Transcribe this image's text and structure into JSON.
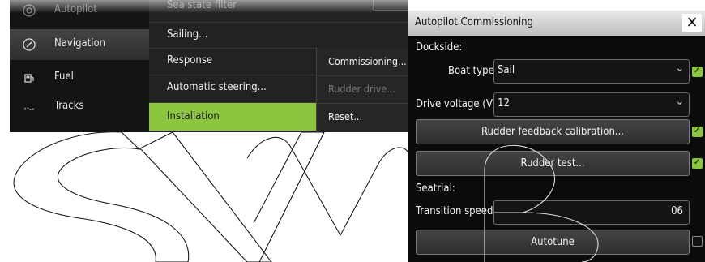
{
  "sidebar": {
    "items": [
      {
        "label": "Autopilot",
        "icon": "autopilot-icon"
      },
      {
        "label": "Navigation",
        "icon": "compass-icon"
      },
      {
        "label": "Fuel",
        "icon": "fuel-icon"
      },
      {
        "label": "Tracks",
        "icon": "tracks-icon"
      }
    ]
  },
  "menu": {
    "items": [
      {
        "label": "Sea state filter"
      },
      {
        "label": "Sailing..."
      },
      {
        "label": "Response"
      },
      {
        "label": "Automatic steering..."
      },
      {
        "label": "Installation"
      }
    ]
  },
  "submenu": {
    "items": [
      {
        "label": "Commissioning..."
      },
      {
        "label": "Rudder drive..."
      },
      {
        "label": "Reset..."
      }
    ]
  },
  "dialog": {
    "title": "Autopilot Commissioning",
    "close_symbol": "✕",
    "dockside_label": "Dockside:",
    "boat_type_label": "Boat type",
    "boat_type_value": "Sail",
    "drive_voltage_label": "Drive voltage (V)",
    "drive_voltage_value": "12",
    "rudder_feedback_button": "Rudder feedback calibration...",
    "rudder_test_button": "Rudder test...",
    "seatrial_label": "Seatrial:",
    "transition_speed_label": "Transition speed",
    "transition_speed_value": "06",
    "autotune_button": "Autotune",
    "dropdown_symbol": "⌄"
  },
  "colors": {
    "accent_green": "#8cc63e",
    "dialog_header": "#d4d4d4",
    "background_dark": "#0d0d0d"
  }
}
